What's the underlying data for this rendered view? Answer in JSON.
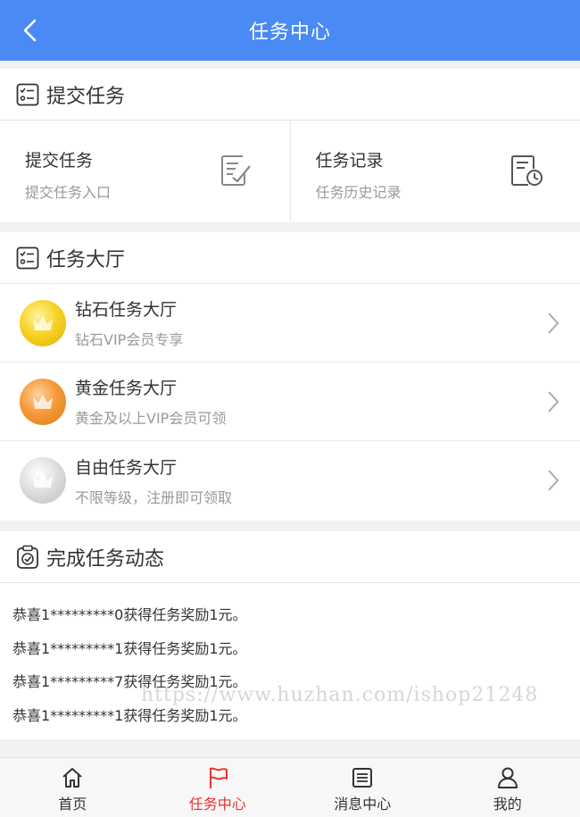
{
  "header": {
    "title": "任务中心"
  },
  "submit_section": {
    "title": "提交任务",
    "cells": [
      {
        "title": "提交任务",
        "subtitle": "提交任务入口"
      },
      {
        "title": "任务记录",
        "subtitle": "任务历史记录"
      }
    ]
  },
  "hall_section": {
    "title": "任务大厅",
    "items": [
      {
        "title": "钻石任务大厅",
        "subtitle": "钻石VIP会员专享",
        "medal": "gold"
      },
      {
        "title": "黄金任务大厅",
        "subtitle": "黄金及以上VIP会员可领",
        "medal": "bronze"
      },
      {
        "title": "自由任务大厅",
        "subtitle": "不限等级，注册即可领取",
        "medal": "silver"
      }
    ]
  },
  "dynamics_section": {
    "title": "完成任务动态",
    "items": [
      "恭喜1*********0获得任务奖励1元。",
      "恭喜1*********1获得任务奖励1元。",
      "恭喜1*********7获得任务奖励1元。",
      "恭喜1*********1获得任务奖励1元。"
    ]
  },
  "watermark": "https://www.huzhan.com/ishop21248",
  "tabbar": {
    "tabs": [
      {
        "label": "首页",
        "icon": "home-icon"
      },
      {
        "label": "任务中心",
        "icon": "flag-icon",
        "active": true
      },
      {
        "label": "消息中心",
        "icon": "message-icon"
      },
      {
        "label": "我的",
        "icon": "user-icon"
      }
    ]
  },
  "colors": {
    "header_bg": "#4a8af4",
    "active_tab": "#e8322f",
    "page_bg": "#f2f2f2"
  }
}
